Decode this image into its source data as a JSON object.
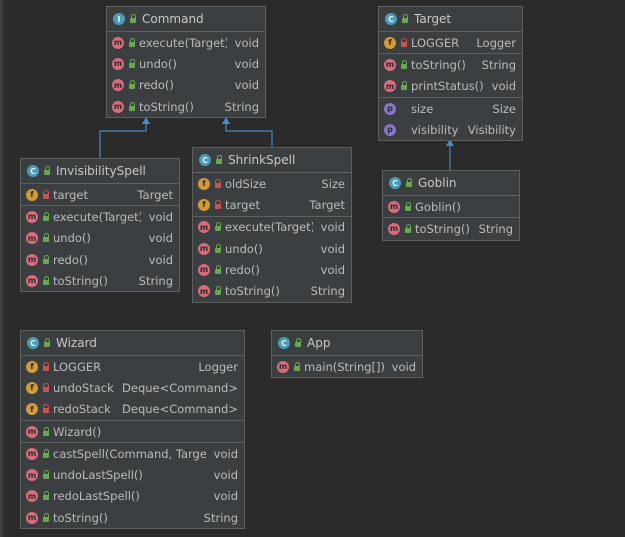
{
  "diagram": {
    "classes": {
      "command": {
        "name": "Command",
        "kind": "interface",
        "members": [
          {
            "name": "execute(Target)",
            "type": "void"
          },
          {
            "name": "undo()",
            "type": "void"
          },
          {
            "name": "redo()",
            "type": "void"
          },
          {
            "name": "toString()",
            "type": "String"
          }
        ]
      },
      "target": {
        "name": "Target",
        "kind": "class",
        "fields": [
          {
            "name": "LOGGER",
            "type": "Logger"
          }
        ],
        "methods": [
          {
            "name": "toString()",
            "type": "String"
          },
          {
            "name": "printStatus()",
            "type": "void"
          }
        ],
        "properties": [
          {
            "name": "size",
            "type": "Size"
          },
          {
            "name": "visibility",
            "type": "Visibility"
          }
        ]
      },
      "invisibility": {
        "name": "InvisibilitySpell",
        "kind": "class",
        "fields": [
          {
            "name": "target",
            "type": "Target"
          }
        ],
        "methods": [
          {
            "name": "execute(Target)",
            "type": "void"
          },
          {
            "name": "undo()",
            "type": "void"
          },
          {
            "name": "redo()",
            "type": "void"
          },
          {
            "name": "toString()",
            "type": "String"
          }
        ]
      },
      "shrink": {
        "name": "ShrinkSpell",
        "kind": "class",
        "fields": [
          {
            "name": "oldSize",
            "type": "Size"
          },
          {
            "name": "target",
            "type": "Target"
          }
        ],
        "methods": [
          {
            "name": "execute(Target)",
            "type": "void"
          },
          {
            "name": "undo()",
            "type": "void"
          },
          {
            "name": "redo()",
            "type": "void"
          },
          {
            "name": "toString()",
            "type": "String"
          }
        ]
      },
      "goblin": {
        "name": "Goblin",
        "kind": "class",
        "methods": [
          {
            "name": "Goblin()",
            "type": ""
          },
          {
            "name": "toString()",
            "type": "String"
          }
        ]
      },
      "wizard": {
        "name": "Wizard",
        "kind": "class",
        "fields": [
          {
            "name": "LOGGER",
            "type": "Logger"
          },
          {
            "name": "undoStack",
            "type": "Deque<Command>"
          },
          {
            "name": "redoStack",
            "type": "Deque<Command>"
          }
        ],
        "constructors": [
          {
            "name": "Wizard()",
            "type": ""
          }
        ],
        "methods": [
          {
            "name": "castSpell(Command, Target)",
            "type": "void"
          },
          {
            "name": "undoLastSpell()",
            "type": "void"
          },
          {
            "name": "redoLastSpell()",
            "type": "void"
          },
          {
            "name": "toString()",
            "type": "String"
          }
        ]
      },
      "app": {
        "name": "App",
        "kind": "class",
        "methods": [
          {
            "name": "main(String[])",
            "type": "void"
          }
        ]
      }
    },
    "badges": {
      "class": "C",
      "interface": "I",
      "method": "m",
      "field": "f",
      "property": "p"
    },
    "colors": {
      "background": "#2b2b2b",
      "box": "#3c3f41",
      "border": "#5e6060",
      "edge": "#4a88c7",
      "class_badge": "#4a9cb8",
      "method_badge": "#d96c7c",
      "field_badge": "#d39a3c",
      "property_badge": "#8a73c9"
    }
  }
}
